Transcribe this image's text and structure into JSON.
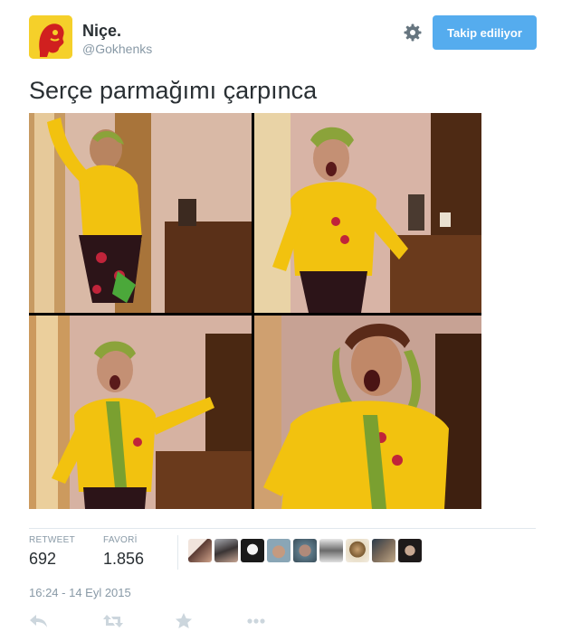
{
  "user": {
    "name": "Niçe.",
    "handle": "@Gokhenks"
  },
  "header": {
    "follow_label": "Takip ediliyor"
  },
  "tweet": {
    "text": "Serçe parmağımı çarpınca",
    "timestamp": "16:24 - 14 Eyl 2015"
  },
  "stats": {
    "retweet_label": "RETWEET",
    "retweet_count": "692",
    "favorite_label": "FAVORİ",
    "favorite_count": "1.856"
  },
  "icons": {
    "settings": "gear-icon",
    "reply": "reply-icon",
    "retweet": "retweet-icon",
    "favorite": "star-icon",
    "more": "more-dots-icon"
  },
  "colors": {
    "accent": "#55acee",
    "icon_gray": "#8899a6",
    "avatar_bg": "#f5d02a",
    "avatar_mark": "#d0201f"
  }
}
